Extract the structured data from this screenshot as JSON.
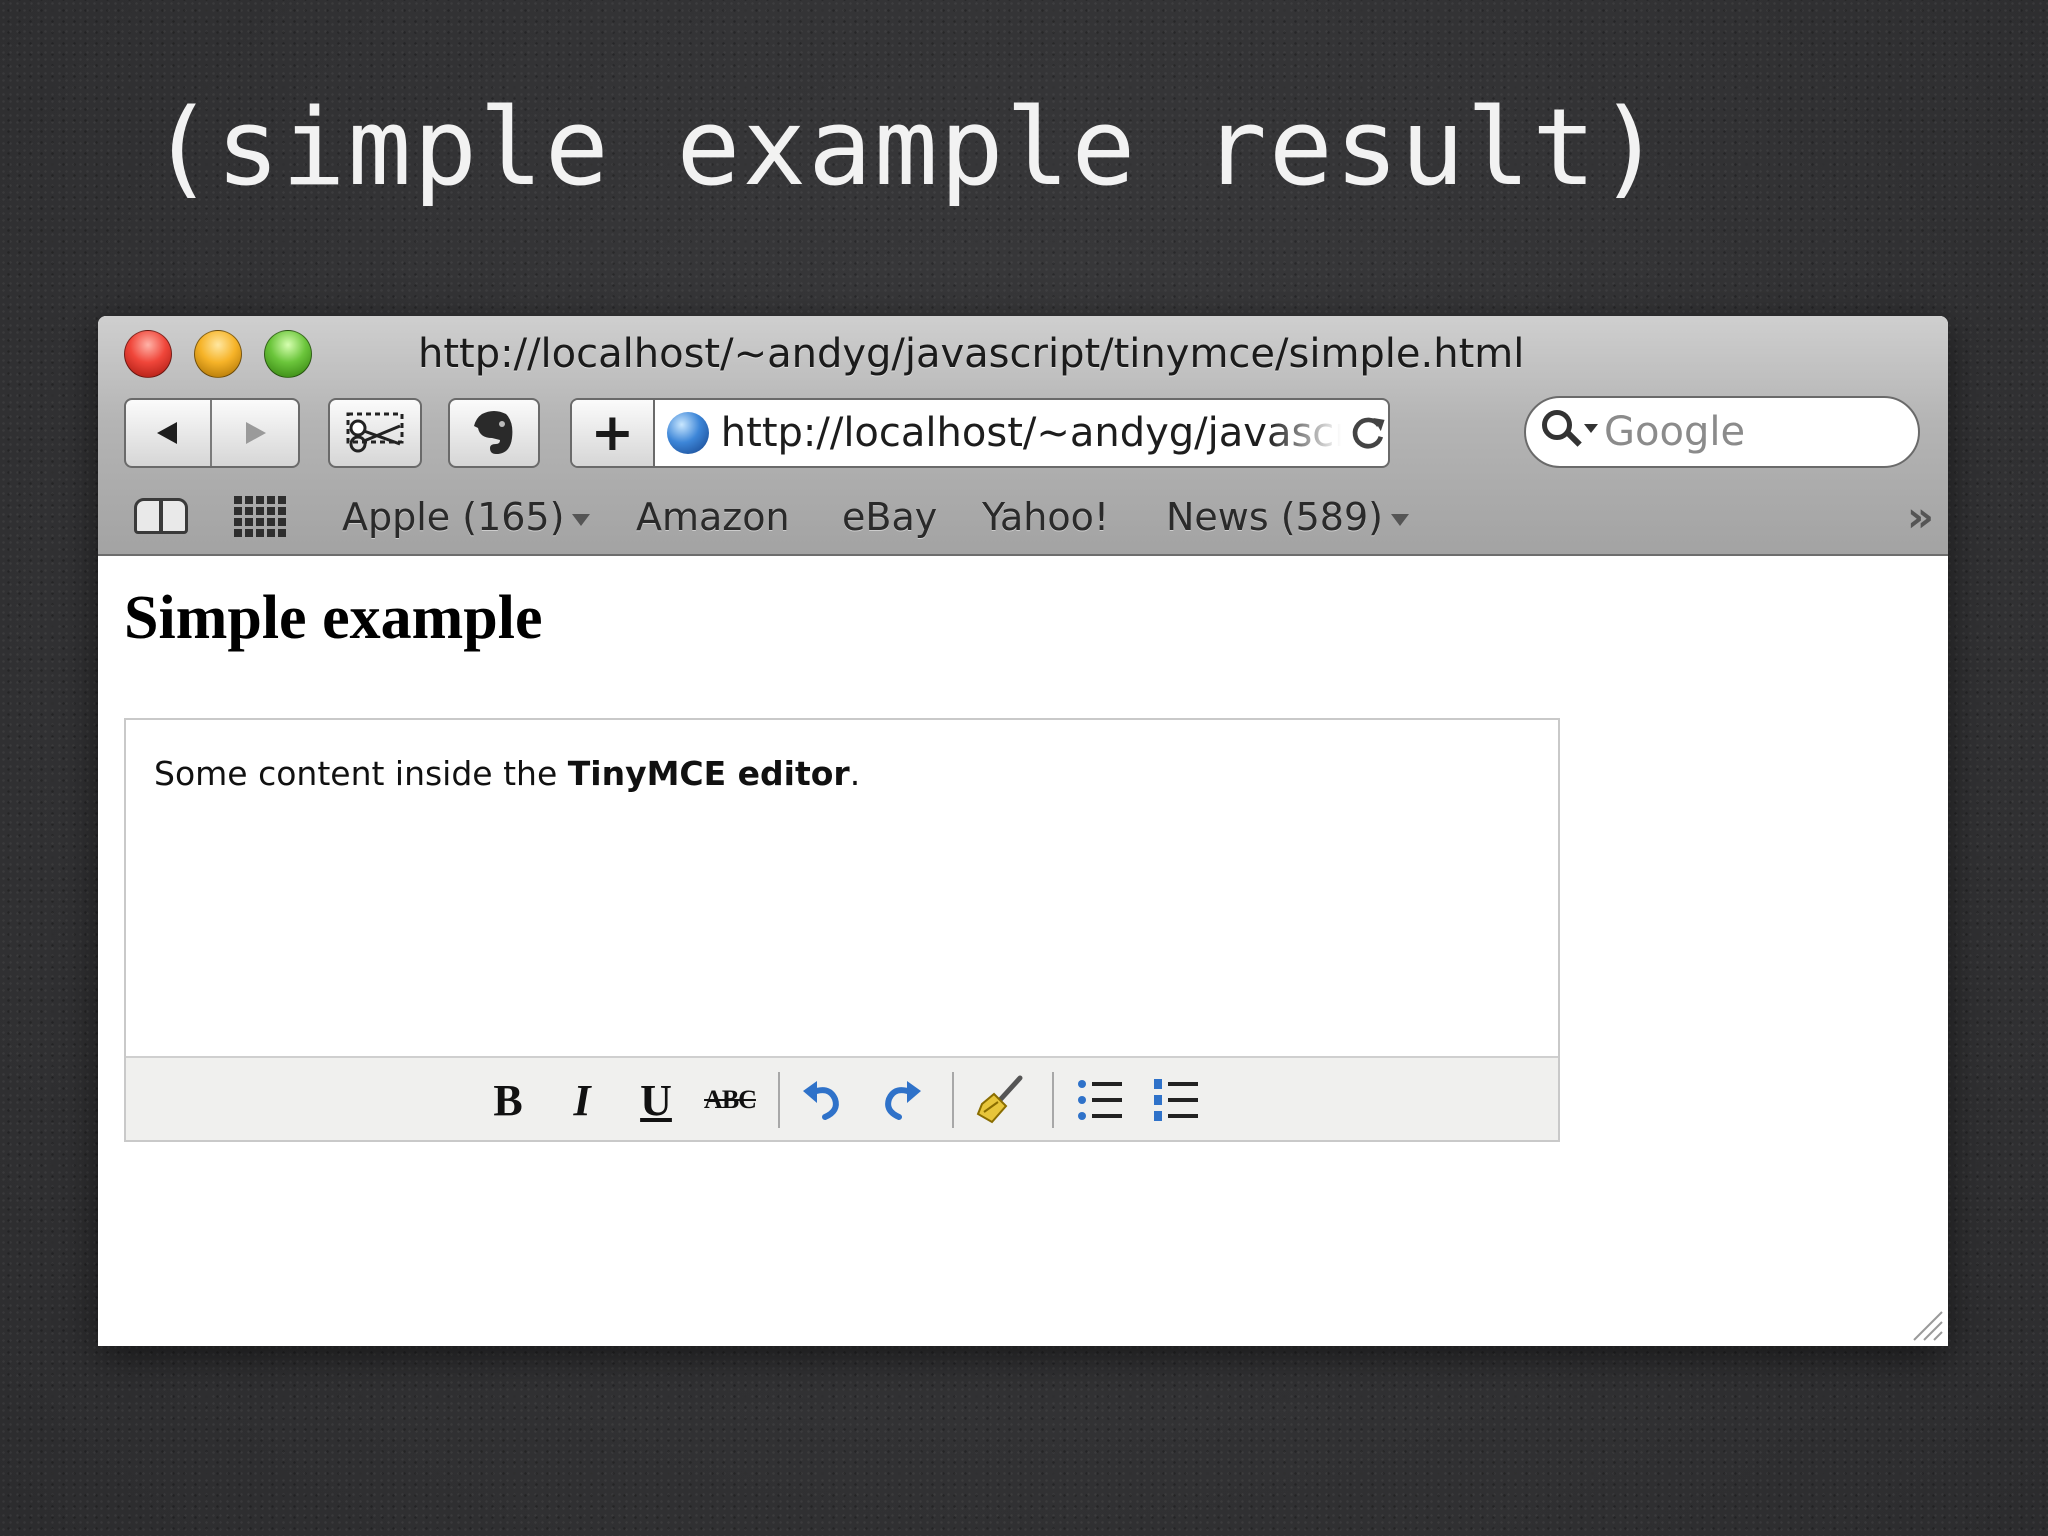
{
  "slide": {
    "title": "(simple example result)"
  },
  "window": {
    "title": "http://localhost/~andyg/javascript/tinymce/simple.html"
  },
  "toolbar": {
    "address": "http://localhost/~andyg/javascript/tinymce/simple.html",
    "add_label": "+",
    "search_placeholder": "Google"
  },
  "bookmarks": {
    "items": [
      {
        "label": "Apple (165)",
        "has_menu": true
      },
      {
        "label": "Amazon",
        "has_menu": false
      },
      {
        "label": "eBay",
        "has_menu": false
      },
      {
        "label": "Yahoo!",
        "has_menu": false
      },
      {
        "label": "News (589)",
        "has_menu": true
      }
    ],
    "more_label": "»"
  },
  "page": {
    "heading": "Simple example",
    "editor": {
      "content_plain": "Some content inside the ",
      "content_bold": "TinyMCE editor",
      "content_end": "."
    },
    "editor_toolbar": {
      "bold_label": "B",
      "italic_label": "I",
      "underline_label": "U",
      "strike_label": "ABC"
    }
  },
  "colors": {
    "slide_bg": "#333335",
    "chrome_top": "#cfcfcf",
    "chrome_bottom": "#a3a3a3",
    "accent_blue": "#2f72c9"
  }
}
